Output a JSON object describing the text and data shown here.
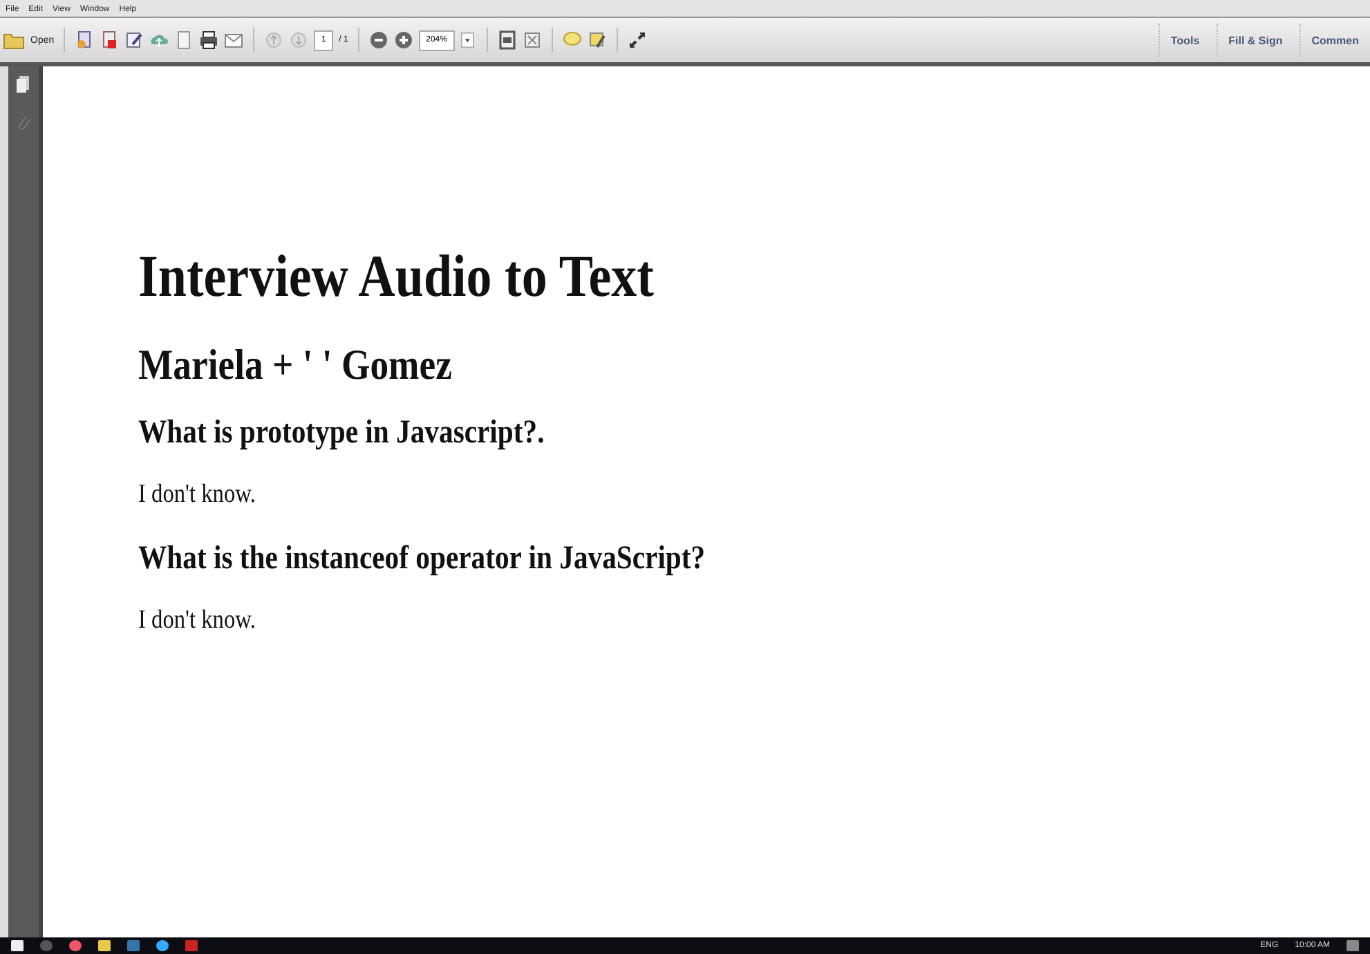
{
  "menu": [
    "File",
    "Edit",
    "View",
    "Window",
    "Help"
  ],
  "toolbar": {
    "open_label": "Open",
    "page_number": "1",
    "page_count": "/ 1",
    "zoom": "204%",
    "panels": [
      "Tools",
      "Fill & Sign",
      "Commen"
    ]
  },
  "document": {
    "title": "Interview Audio to Text",
    "candidate": "Mariela + ' ' Gomez",
    "qa": [
      {
        "question": "What is prototype in Javascript?.",
        "answer": "I don't know."
      },
      {
        "question": "What is the instanceof operator in JavaScript?",
        "answer": "I don't know."
      }
    ]
  },
  "taskbar": {
    "language": "ENG",
    "time": "10:00 AM"
  }
}
